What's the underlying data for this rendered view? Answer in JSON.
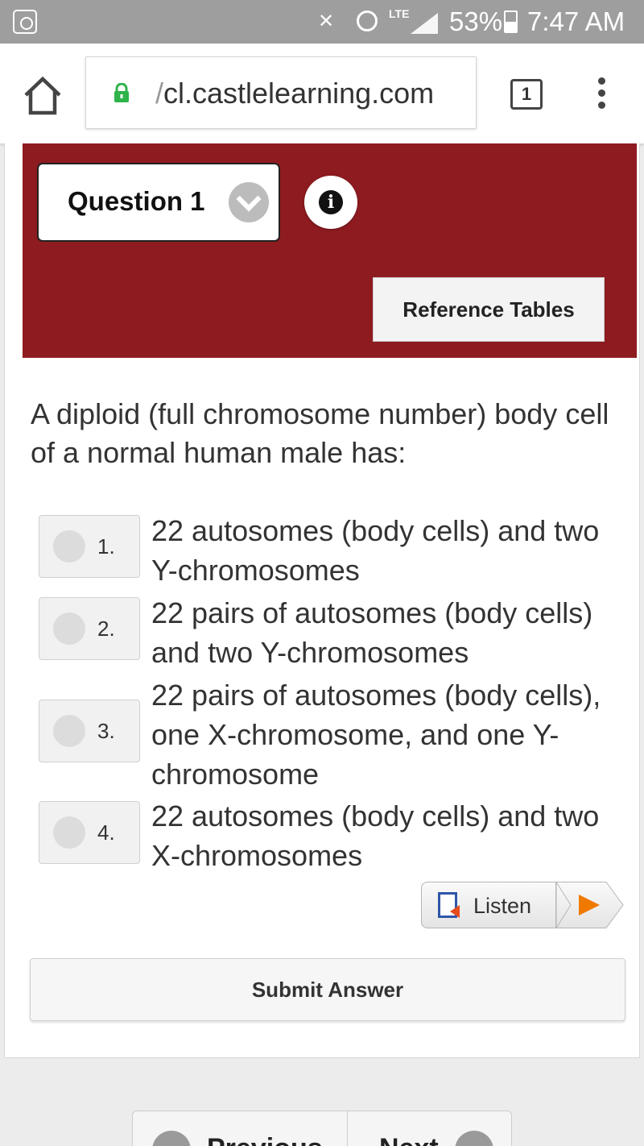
{
  "status_bar": {
    "battery": "53%",
    "time": "7:47 AM",
    "network": "LTE",
    "icons": [
      "recycle-icon",
      "mute-icon",
      "alarm-icon",
      "signal-icon",
      "battery-icon"
    ]
  },
  "browser": {
    "url_prefix": "/",
    "url_host": "cl.castlelearning.com",
    "tab_count": "1",
    "lock_color": "#2fb34a"
  },
  "header": {
    "background": "#8e1b20",
    "question_select": "Question 1",
    "info_icon": "i",
    "reference_button": "Reference Tables"
  },
  "question": {
    "text": "A diploid (full chromosome number) body cell of a normal human male has:",
    "options": [
      {
        "number": "1.",
        "text": "22 autosomes (body cells) and two Y-chromosomes"
      },
      {
        "number": "2.",
        "text": "22 pairs of autosomes (body cells) and two Y-chromosomes"
      },
      {
        "number": "3.",
        "text": "22 pairs of autosomes (body cells), one X-chromosome, and one Y-chromosome"
      },
      {
        "number": "4.",
        "text": "22 autosomes (body cells) and two X-chromosomes"
      }
    ]
  },
  "listen": {
    "label": "Listen"
  },
  "submit": {
    "label": "Submit Answer"
  },
  "navigation": {
    "previous": "Previous",
    "next": "Next"
  }
}
